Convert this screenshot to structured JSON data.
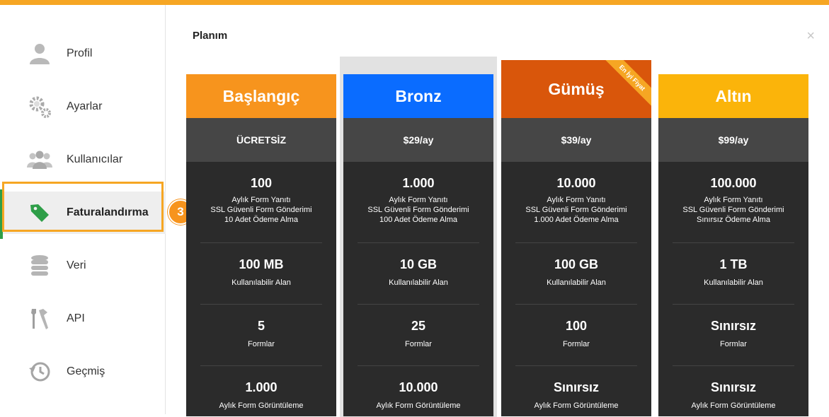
{
  "sidebar": {
    "items": [
      {
        "label": "Profil",
        "icon": "user-icon"
      },
      {
        "label": "Ayarlar",
        "icon": "gears-icon"
      },
      {
        "label": "Kullanıcılar",
        "icon": "users-icon"
      },
      {
        "label": "Faturalandırma",
        "icon": "tag-icon",
        "active": true
      },
      {
        "label": "Veri",
        "icon": "database-icon"
      },
      {
        "label": "API",
        "icon": "tools-icon"
      },
      {
        "label": "Geçmiş",
        "icon": "history-icon"
      }
    ]
  },
  "step_badge": "3",
  "main": {
    "title": "Planım",
    "close": "×"
  },
  "plans": [
    {
      "name": "Başlangıç",
      "color": "#f7941d",
      "price": "ÜCRETSİZ",
      "submissions": {
        "value": "100",
        "lines": [
          "Aylık Form Yanıtı",
          "SSL Güvenli Form Gönderimi",
          "10 Adet Ödeme Alma"
        ]
      },
      "storage": {
        "value": "100 MB",
        "label": "Kullanılabilir Alan"
      },
      "forms": {
        "value": "5",
        "label": "Formlar"
      },
      "views": {
        "value": "1.000",
        "label": "Aylık Form Görüntüleme"
      }
    },
    {
      "name": "Bronz",
      "color": "#0a6cff",
      "price": "$29/ay",
      "submissions": {
        "value": "1.000",
        "lines": [
          "Aylık Form Yanıtı",
          "SSL Güvenli Form Gönderimi",
          "100 Adet Ödeme Alma"
        ]
      },
      "storage": {
        "value": "10 GB",
        "label": "Kullanılabilir Alan"
      },
      "forms": {
        "value": "25",
        "label": "Formlar"
      },
      "views": {
        "value": "10.000",
        "label": "Aylık Form Görüntüleme"
      }
    },
    {
      "name": "Gümüş",
      "color": "#d9560b",
      "price": "$39/ay",
      "ribbon": "En İyi Fiyat",
      "submissions": {
        "value": "10.000",
        "lines": [
          "Aylık Form Yanıtı",
          "SSL Güvenli Form Gönderimi",
          "1.000 Adet Ödeme Alma"
        ]
      },
      "storage": {
        "value": "100 GB",
        "label": "Kullanılabilir Alan"
      },
      "forms": {
        "value": "100",
        "label": "Formlar"
      },
      "views": {
        "value": "Sınırsız",
        "label": "Aylık Form Görüntüleme"
      }
    },
    {
      "name": "Altın",
      "color": "#fbb40a",
      "price": "$99/ay",
      "submissions": {
        "value": "100.000",
        "lines": [
          "Aylık Form Yanıtı",
          "SSL Güvenli Form Gönderimi",
          "Sınırsız Ödeme Alma"
        ]
      },
      "storage": {
        "value": "1 TB",
        "label": "Kullanılabilir Alan"
      },
      "forms": {
        "value": "Sınırsız",
        "label": "Formlar"
      },
      "views": {
        "value": "Sınırsız",
        "label": "Aylık Form Görüntüleme"
      }
    }
  ]
}
